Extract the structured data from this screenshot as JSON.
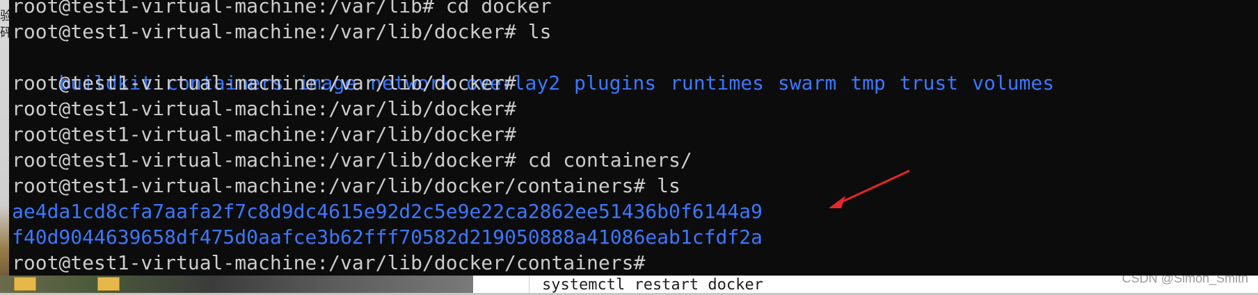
{
  "background": {
    "left_chars": "验\n砰",
    "editor_text": "systemctl restart docker",
    "watermark": "CSDN @Simon_Smith"
  },
  "terminal": {
    "lines": [
      {
        "type": "cmd",
        "text": "root@test1-virtual-machine:/var/lib# cd docker"
      },
      {
        "type": "cmd",
        "text": "root@test1-virtual-machine:/var/lib/docker# ls"
      },
      {
        "type": "dirs",
        "items": [
          "buildkit",
          "containers",
          "image",
          "network",
          "overlay2",
          "plugins",
          "runtimes",
          "swarm",
          "tmp",
          "trust",
          "volumes"
        ]
      },
      {
        "type": "cmd",
        "text": "root@test1-virtual-machine:/var/lib/docker#"
      },
      {
        "type": "cmd",
        "text": "root@test1-virtual-machine:/var/lib/docker#"
      },
      {
        "type": "cmd",
        "text": "root@test1-virtual-machine:/var/lib/docker#"
      },
      {
        "type": "cmd",
        "text": "root@test1-virtual-machine:/var/lib/docker# cd containers/"
      },
      {
        "type": "cmd",
        "text": "root@test1-virtual-machine:/var/lib/docker/containers# ls"
      },
      {
        "type": "hash",
        "text": "ae4da1cd8cfa7aafa2f7c8d9dc4615e92d2c5e9e22ca2862ee51436b0f6144a9"
      },
      {
        "type": "hash",
        "text": "f40d9044639658df475d0aafce3b62fff70582d219050888a41086eab1cfdf2a"
      },
      {
        "type": "cmd",
        "text": "root@test1-virtual-machine:/var/lib/docker/containers#"
      }
    ],
    "text_color": "#cccccc",
    "dir_color": "#3b78ff",
    "annotation_color": "#e8262b"
  }
}
